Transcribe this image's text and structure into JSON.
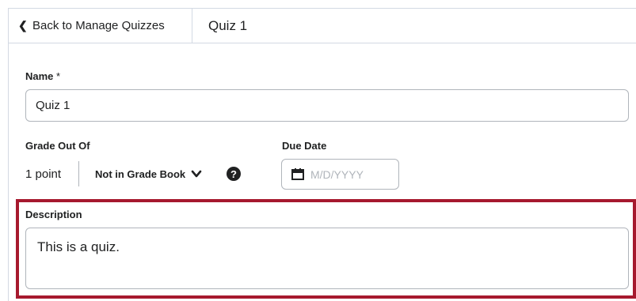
{
  "header": {
    "back_label": "Back to Manage Quizzes",
    "title": "Quiz 1"
  },
  "form": {
    "name_label": "Name",
    "name_required_mark": "*",
    "name_value": "Quiz 1",
    "grade_label": "Grade Out Of",
    "grade_value": "1 point",
    "gradebook_label": "Not in Grade Book",
    "help_glyph": "?",
    "due_label": "Due Date",
    "due_placeholder": "M/D/YYYY",
    "description_label": "Description",
    "description_value": "This is a quiz."
  },
  "colors": {
    "highlight": "#a6192e",
    "border": "#b0b5bb",
    "text": "#202122"
  }
}
